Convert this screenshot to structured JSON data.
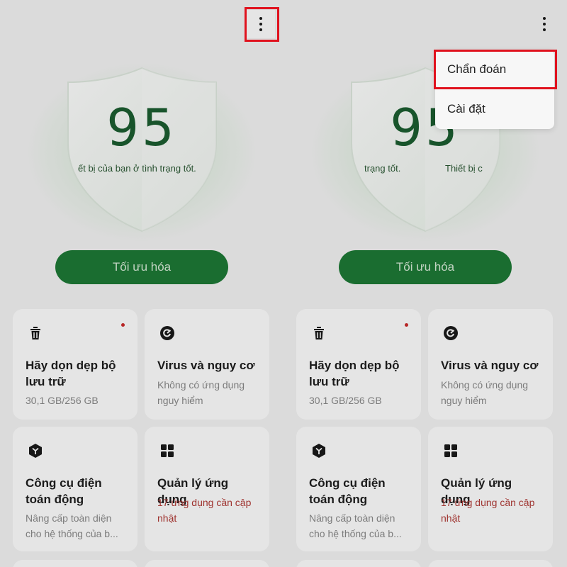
{
  "score": "95",
  "status_text": "Thiết bị của bạn ở tình trạng tốt.",
  "status_left_visible": "ết bị của bạn ở tình trạng tốt.",
  "status_right_part1": "trạng tốt.",
  "status_right_part2": "Thiết bị c",
  "optimize_button": "Tối ưu hóa",
  "cards": [
    {
      "icon": "trash-icon",
      "title": "Hãy dọn dẹp bộ lưu trữ",
      "subtitle": "30,1 GB/256 GB",
      "subtitle_alert": false,
      "has_dot": true
    },
    {
      "icon": "virus-scan-icon",
      "title": "Virus và nguy cơ",
      "subtitle": "Không có ứng dụng nguy hiểm",
      "subtitle_alert": false,
      "has_dot": false
    },
    {
      "icon": "cube-icon",
      "title": "Công cụ điện toán động",
      "subtitle": "Nâng cấp toàn diện cho hệ thống của b...",
      "subtitle_alert": false,
      "has_dot": false
    },
    {
      "icon": "app-grid-icon",
      "title": "Quản lý ứng dụng",
      "subtitle": "17 ứng dụng cần cập nhật",
      "subtitle_alert": true,
      "has_dot": false
    }
  ],
  "menu": {
    "items": [
      "Chẩn đoán",
      "Cài đặt"
    ]
  },
  "colors": {
    "accent": "#1e7a36",
    "score": "#1b5e30",
    "highlight": "#e0121e",
    "alert_text": "#b23a36"
  }
}
